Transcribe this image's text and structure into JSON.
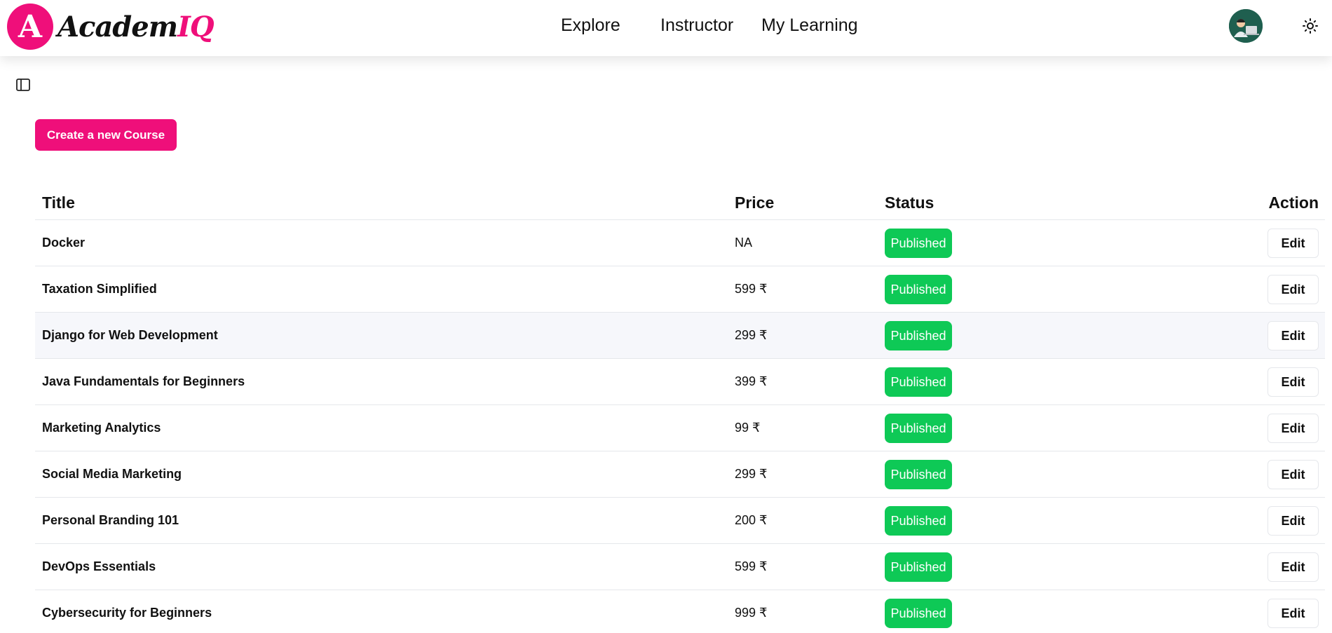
{
  "brand": {
    "badge_letter": "A",
    "name_main": "Academ",
    "name_accent": "IQ",
    "accent_color": "#ef0f7a"
  },
  "nav": {
    "explore": "Explore",
    "instructor": "Instructor",
    "my_learning": "My Learning"
  },
  "icons": {
    "sidebar_toggle": "sidebar-toggle-icon",
    "theme": "sun-icon",
    "avatar": "user-avatar"
  },
  "actions": {
    "create_course": "Create a new Course"
  },
  "table": {
    "headers": {
      "title": "Title",
      "price": "Price",
      "status": "Status",
      "action": "Action"
    },
    "rows": [
      {
        "title": "Docker",
        "price": "NA",
        "status": "Published",
        "action": "Edit"
      },
      {
        "title": "Taxation Simplified",
        "price": "599 ₹",
        "status": "Published",
        "action": "Edit"
      },
      {
        "title": "Django for Web Development",
        "price": "299 ₹",
        "status": "Published",
        "action": "Edit"
      },
      {
        "title": "Java Fundamentals for Beginners",
        "price": "399 ₹",
        "status": "Published",
        "action": "Edit"
      },
      {
        "title": "Marketing Analytics",
        "price": "99 ₹",
        "status": "Published",
        "action": "Edit"
      },
      {
        "title": "Social Media Marketing",
        "price": "299 ₹",
        "status": "Published",
        "action": "Edit"
      },
      {
        "title": "Personal Branding 101",
        "price": "200 ₹",
        "status": "Published",
        "action": "Edit"
      },
      {
        "title": "DevOps Essentials",
        "price": "599 ₹",
        "status": "Published",
        "action": "Edit"
      },
      {
        "title": "Cybersecurity for Beginners",
        "price": "999 ₹",
        "status": "Published",
        "action": "Edit"
      }
    ]
  },
  "colors": {
    "published_badge": "#0ec956",
    "primary_button": "#ef0f7a",
    "highlight_row": "#f6f7fb"
  }
}
